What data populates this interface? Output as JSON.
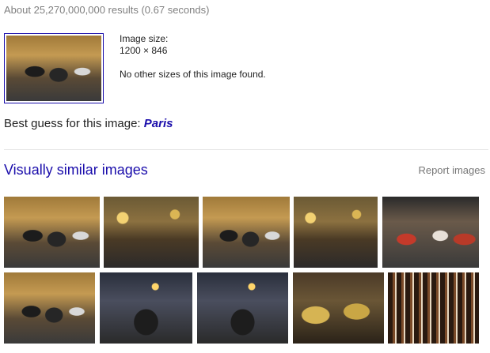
{
  "stats": "About 25,270,000,000 results (0.67 seconds)",
  "result": {
    "image_size_label": "Image size:",
    "image_size_value": "1200 × 846",
    "no_other_sizes": "No other sizes of this image found."
  },
  "best_guess": {
    "prefix": "Best guess for this image:",
    "term": "Paris"
  },
  "similar": {
    "title": "Visually similar images",
    "report": "Report images"
  },
  "colors": {
    "link": "#1a0dab",
    "muted": "#808080",
    "divider": "#e5e5e5"
  }
}
